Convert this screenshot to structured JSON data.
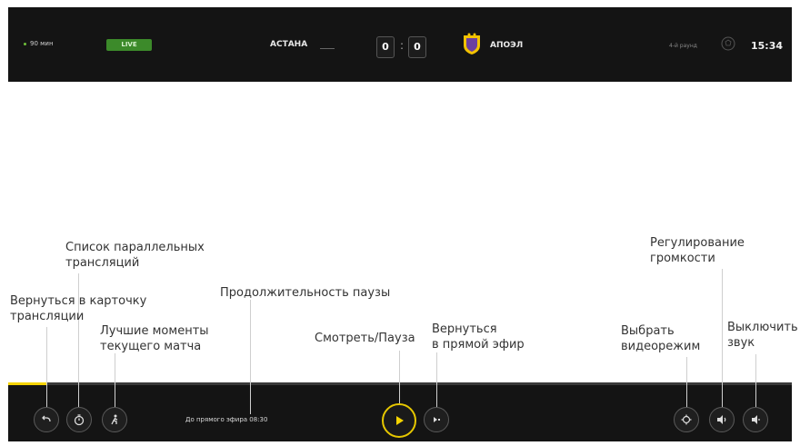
{
  "topbar": {
    "channel_label": "90 мин",
    "live_badge": "LIVE",
    "team_a": "АСТАНА",
    "score_a": "0",
    "score_sep": ":",
    "score_b": "0",
    "team_b": "АПОЭЛ",
    "round_label": "4-й раунд",
    "time": "15:34",
    "colors": {
      "live": "#3c8a2a",
      "accent": "#f5d400",
      "bar": "#141414"
    }
  },
  "player": {
    "progress": 0.05,
    "pause_duration_text": "До прямого эфира 08:30",
    "icons": [
      "back-icon",
      "timer-icon",
      "highlights-icon",
      "play-icon",
      "live-forward-icon",
      "video-mode-icon",
      "volume-icon",
      "mute-icon"
    ]
  },
  "annotations": {
    "back": "Вернуться в карточку\nтрансляции",
    "parallel": "Список параллельных\nтрансляций",
    "highlights": "Лучшие моменты\nтекущего матча",
    "pause_duration": "Продолжительность паузы",
    "play_pause": "Смотреть/Пауза",
    "back_to_live": "Вернуться\nв прямой эфир",
    "video_mode": "Выбрать\nвидеорежим",
    "volume": "Регулирование\nгромкости",
    "mute": "Выключить\nзвук"
  }
}
